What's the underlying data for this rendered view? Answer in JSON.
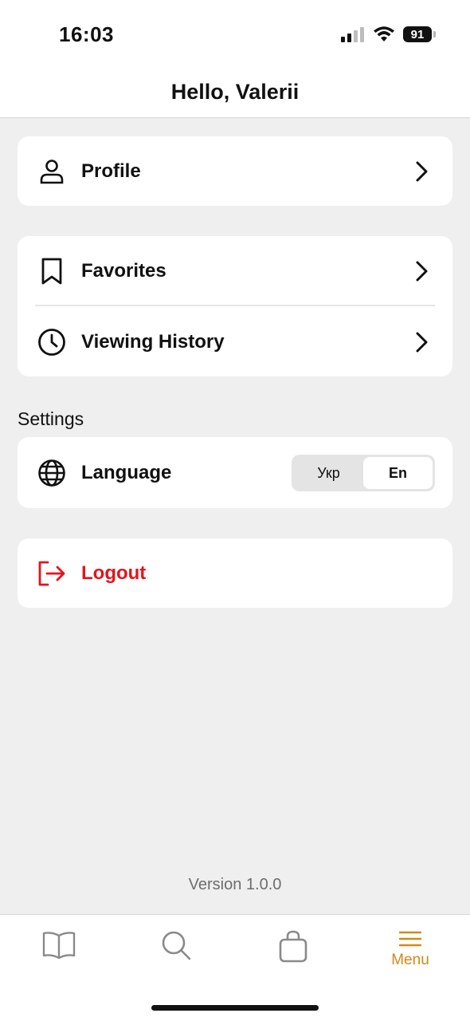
{
  "status_bar": {
    "time": "16:03",
    "battery": "91"
  },
  "header": {
    "title": "Hello, Valerii"
  },
  "menu": {
    "profile_label": "Profile",
    "favorites_label": "Favorites",
    "history_label": "Viewing History"
  },
  "settings": {
    "section_label": "Settings",
    "language_label": "Language",
    "language_options": [
      "Укр",
      "En"
    ],
    "language_selected": "En"
  },
  "logout": {
    "label": "Logout",
    "color": "#e3141c"
  },
  "footer": {
    "version": "Version 1.0.0"
  },
  "tabbar": {
    "tabs": [
      {
        "icon": "book-icon",
        "label": ""
      },
      {
        "icon": "search-icon",
        "label": ""
      },
      {
        "icon": "bag-icon",
        "label": ""
      },
      {
        "icon": "menu-icon",
        "label": "Menu",
        "active": true
      }
    ],
    "active_color": "#d28a16"
  }
}
